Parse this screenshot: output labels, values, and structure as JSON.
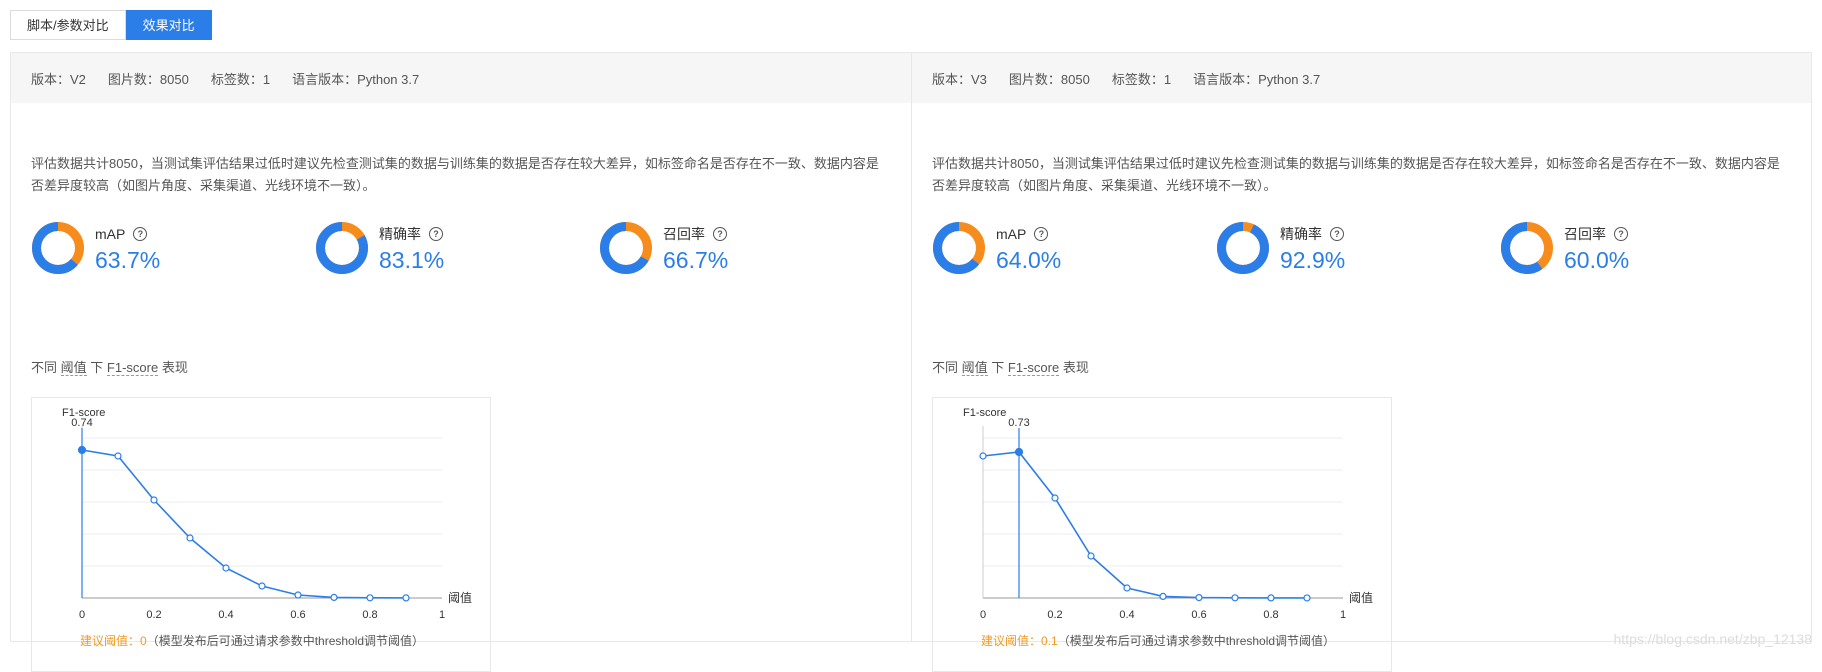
{
  "tabs": [
    {
      "label": "脚本/参数对比",
      "active": false
    },
    {
      "label": "效果对比",
      "active": true
    }
  ],
  "panels": [
    {
      "meta": {
        "version": "版本：V2",
        "images": "图片数：8050",
        "labels": "标签数：1",
        "language": "语言版本：Python 3.7"
      },
      "description": "评估数据共计8050，当测试集评估结果过低时建议先检查测试集的数据与训练集的数据是否存在较大差异，如标签命名是否存在不一致、数据内容是否差异度较高（如图片角度、采集渠道、光线环境不一致）。",
      "metrics": [
        {
          "label": "mAP",
          "value": "63.7%",
          "ratio": 0.637,
          "help_icon": "question-circle-icon"
        },
        {
          "label": "精确率",
          "value": "83.1%",
          "ratio": 0.831,
          "help_icon": "question-circle-icon"
        },
        {
          "label": "召回率",
          "value": "66.7%",
          "ratio": 0.667,
          "help_icon": "question-circle-icon"
        }
      ],
      "section_title": {
        "p1": "不同",
        "p2": "阈值",
        "p3": "下",
        "p4": "F1-score",
        "p5": "表现"
      },
      "threshold_note": {
        "prefix": "建议阈值：0",
        "suffix": "（模型发布后可通过请求参数中threshold调节阈值）"
      },
      "chart_data": {
        "type": "line",
        "xlabel": "阈值",
        "ylabel": "F1-score",
        "xlim": [
          0,
          1
        ],
        "x_ticks": [
          "0",
          "0.2",
          "0.4",
          "0.6",
          "0.8",
          "1"
        ],
        "x": [
          0,
          0.1,
          0.2,
          0.3,
          0.4,
          0.5,
          0.6,
          0.7,
          0.8,
          0.9
        ],
        "y": [
          0.74,
          0.71,
          0.49,
          0.3,
          0.15,
          0.06,
          0.015,
          0.003,
          0.001,
          0.0005
        ],
        "highlight_x": 0,
        "highlight_label": "0.74",
        "grid": true,
        "color": "#2b7ee8"
      }
    },
    {
      "meta": {
        "version": "版本：V3",
        "images": "图片数：8050",
        "labels": "标签数：1",
        "language": "语言版本：Python 3.7"
      },
      "description": "评估数据共计8050，当测试集评估结果过低时建议先检查测试集的数据与训练集的数据是否存在较大差异，如标签命名是否存在不一致、数据内容是否差异度较高（如图片角度、采集渠道、光线环境不一致）。",
      "metrics": [
        {
          "label": "mAP",
          "value": "64.0%",
          "ratio": 0.64,
          "help_icon": "question-circle-icon"
        },
        {
          "label": "精确率",
          "value": "92.9%",
          "ratio": 0.929,
          "help_icon": "question-circle-icon"
        },
        {
          "label": "召回率",
          "value": "60.0%",
          "ratio": 0.6,
          "help_icon": "question-circle-icon"
        }
      ],
      "section_title": {
        "p1": "不同",
        "p2": "阈值",
        "p3": "下",
        "p4": "F1-score",
        "p5": "表现"
      },
      "threshold_note": {
        "prefix": "建议阈值：0.1",
        "suffix": "（模型发布后可通过请求参数中threshold调节阈值）"
      },
      "chart_data": {
        "type": "line",
        "xlabel": "阈值",
        "ylabel": "F1-score",
        "xlim": [
          0,
          1
        ],
        "x_ticks": [
          "0",
          "0.2",
          "0.4",
          "0.6",
          "0.8",
          "1"
        ],
        "x": [
          0,
          0.1,
          0.2,
          0.3,
          0.4,
          0.5,
          0.6,
          0.7,
          0.8,
          0.9
        ],
        "y": [
          0.71,
          0.73,
          0.5,
          0.21,
          0.05,
          0.008,
          0.002,
          0.001,
          0.0005,
          0.0002
        ],
        "highlight_x": 0.1,
        "highlight_label": "0.73",
        "grid": true,
        "color": "#2b7ee8"
      }
    }
  ],
  "colors": {
    "accent": "#2b7ee8",
    "donut_remainder": "#f58c1c",
    "note_orange": "#f09a23"
  },
  "watermark": "https://blog.csdn.net/zbp_12138"
}
